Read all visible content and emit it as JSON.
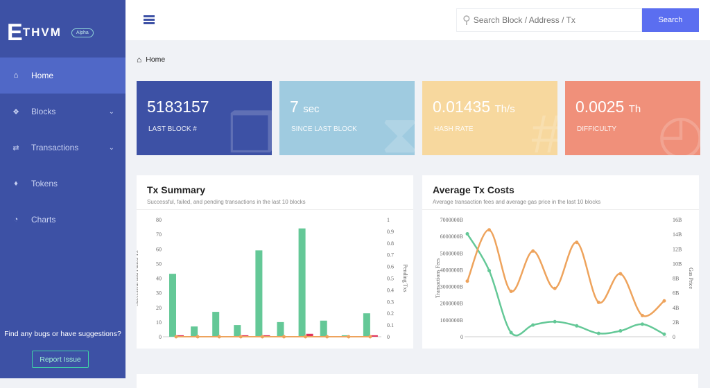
{
  "brand": {
    "name": "THVM",
    "logo_letter": "E",
    "badge": "Alpha"
  },
  "sidebar": {
    "items": [
      {
        "label": "Home",
        "icon": "home-icon",
        "active": true
      },
      {
        "label": "Blocks",
        "icon": "cubes-icon",
        "chevron": true
      },
      {
        "label": "Transactions",
        "icon": "exchange-icon",
        "chevron": true
      },
      {
        "label": "Tokens",
        "icon": "ethereum-icon"
      },
      {
        "label": "Charts",
        "icon": "pie-chart-icon"
      }
    ],
    "bugs_text": "Find any bugs or have suggestions?",
    "report_label": "Report Issue"
  },
  "search": {
    "placeholder": "Search Block / Address / Tx",
    "button": "Search"
  },
  "breadcrumb": {
    "label": "Home"
  },
  "stats": [
    {
      "value": "5183157",
      "unit": "",
      "label": "LAST BLOCK #",
      "color": "#3d51a5",
      "icon": "cubes-icon"
    },
    {
      "value": "7",
      "unit": "sec",
      "label": "SINCE LAST BLOCK",
      "color": "#9fcbe0",
      "icon": "hourglass-icon"
    },
    {
      "value": "0.01435",
      "unit": "Th/s",
      "label": "HASH RATE",
      "color": "#f7d89e",
      "icon": "hash-icon"
    },
    {
      "value": "0.0025",
      "unit": "Th",
      "label": "DIFFICULTY",
      "color": "#f0907a",
      "icon": "gauge-icon"
    }
  ],
  "colors": {
    "green": "#64c897",
    "red": "#e0345a",
    "orange": "#eea35c"
  },
  "chart_data": [
    {
      "type": "bar",
      "title": "Tx Summary",
      "subtitle": "Successful, failed, and pending transactions in the last 10 blocks",
      "ylabel": "Successful and Failed Tx",
      "y2label": "Pending Txs",
      "ylim": [
        0,
        80
      ],
      "y2lim": [
        0,
        1
      ],
      "yticks": [
        "0",
        "10",
        "20",
        "30",
        "40",
        "50",
        "60",
        "70",
        "80"
      ],
      "y2ticks": [
        "0",
        "0.1",
        "0.2",
        "0.3",
        "0.4",
        "0.5",
        "0.6",
        "0.7",
        "0.8",
        "0.9",
        "1"
      ],
      "series": [
        {
          "values": [
            43,
            7,
            17,
            8,
            59,
            10,
            74,
            11,
            1,
            16
          ],
          "color": "#64c897"
        },
        {
          "values": [
            1,
            0,
            0,
            1,
            1,
            0,
            2,
            0,
            0,
            1
          ],
          "color": "#e0345a"
        },
        {
          "values": [
            0,
            0,
            0,
            0,
            0,
            0,
            0,
            0,
            0,
            0
          ],
          "color": "#eea35c",
          "axis": "right",
          "kind": "line"
        }
      ]
    },
    {
      "type": "line",
      "title": "Average Tx Costs",
      "subtitle": "Average transaction fees and average gas price in the last 10 blocks",
      "ylabel": "Transactions Fees",
      "y2label": "Gas Price",
      "ylim": [
        0,
        7000000
      ],
      "y2lim": [
        0,
        16
      ],
      "yticks": [
        "0",
        "1000000B",
        "2000000B",
        "3000000B",
        "4000000B",
        "5000000B",
        "6000000B",
        "7000000B"
      ],
      "y2ticks": [
        "0",
        "2B",
        "4B",
        "6B",
        "8B",
        "10B",
        "12B",
        "14B",
        "16B"
      ],
      "series": [
        {
          "values": [
            6150000,
            3950000,
            250000,
            700000,
            900000,
            650000,
            200000,
            350000,
            750000,
            150000
          ],
          "color": "#64c897"
        },
        {
          "values": [
            7.6,
            14.6,
            6.2,
            11.7,
            6.6,
            12.9,
            4.7,
            8.6,
            2.9,
            4.9
          ],
          "color": "#eea35c",
          "axis": "right"
        }
      ]
    }
  ]
}
